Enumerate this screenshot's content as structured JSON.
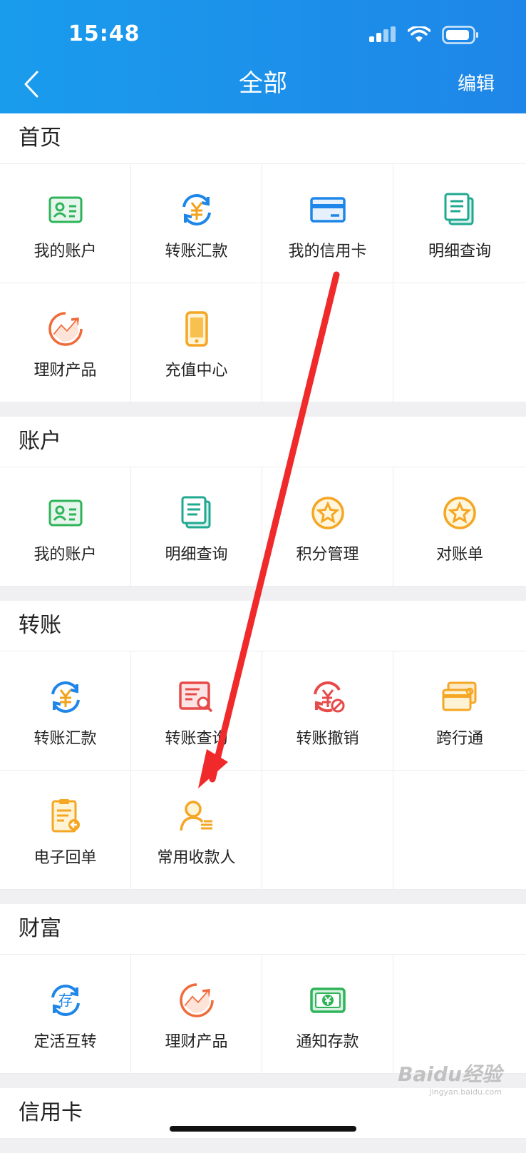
{
  "status_bar": {
    "time": "15:48"
  },
  "header": {
    "title": "全部",
    "edit_label": "编辑"
  },
  "sections": [
    {
      "title": "首页",
      "items": [
        {
          "label": "我的账户",
          "icon": "id-card-icon"
        },
        {
          "label": "转账汇款",
          "icon": "yuan-transfer-icon"
        },
        {
          "label": "我的信用卡",
          "icon": "credit-card-icon"
        },
        {
          "label": "明细查询",
          "icon": "document-list-icon"
        },
        {
          "label": "理财产品",
          "icon": "trend-chart-icon"
        },
        {
          "label": "充值中心",
          "icon": "phone-icon"
        }
      ]
    },
    {
      "title": "账户",
      "items": [
        {
          "label": "我的账户",
          "icon": "id-card-icon"
        },
        {
          "label": "明细查询",
          "icon": "document-list-icon"
        },
        {
          "label": "积分管理",
          "icon": "star-icon"
        },
        {
          "label": "对账单",
          "icon": "star-icon"
        }
      ]
    },
    {
      "title": "转账",
      "items": [
        {
          "label": "转账汇款",
          "icon": "yuan-transfer-icon"
        },
        {
          "label": "转账查询",
          "icon": "search-document-icon"
        },
        {
          "label": "转账撤销",
          "icon": "cancel-transfer-icon"
        },
        {
          "label": "跨行通",
          "icon": "cards-icon"
        },
        {
          "label": "电子回单",
          "icon": "receipt-icon"
        },
        {
          "label": "常用收款人",
          "icon": "payee-icon"
        }
      ]
    },
    {
      "title": "财富",
      "items": [
        {
          "label": "定活互转",
          "icon": "deposit-icon"
        },
        {
          "label": "理财产品",
          "icon": "trend-chart-icon"
        },
        {
          "label": "通知存款",
          "icon": "money-icon"
        }
      ]
    },
    {
      "title": "信用卡",
      "items": []
    }
  ],
  "watermark": {
    "text": "Baidu经验",
    "url": "jingyan.baidu.com"
  },
  "colors": {
    "header": "#1a9cec",
    "arrow": "#f02a2a"
  }
}
